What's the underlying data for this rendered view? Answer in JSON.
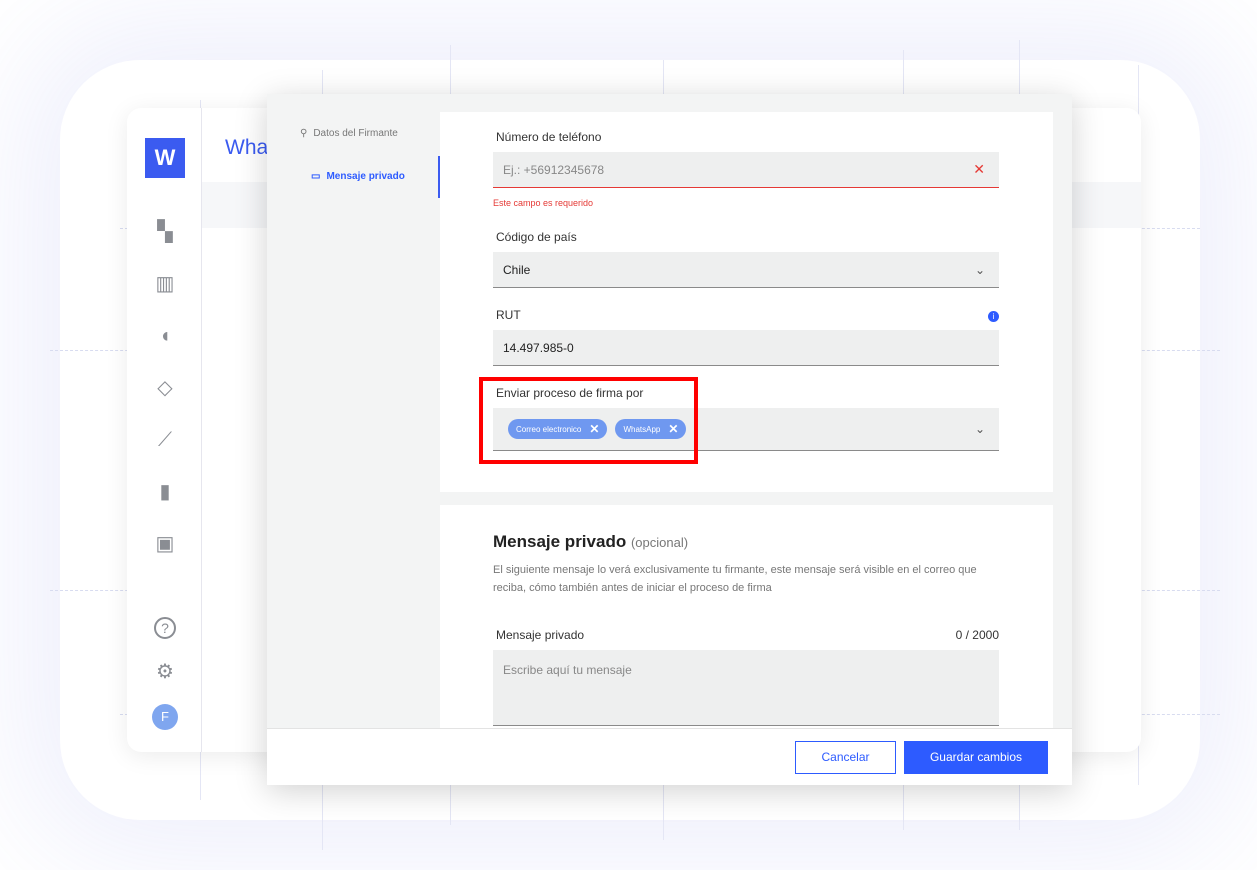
{
  "app": {
    "title_partial": "What",
    "logo": "W",
    "avatar_initial": "F",
    "accent": "#2d5bff"
  },
  "sidebar": {
    "icons": [
      "dashboard-icon",
      "library-icon",
      "contacts-icon",
      "templates-icon",
      "signature-feather-icon",
      "stats-icon",
      "inbox-icon",
      "help-icon",
      "settings-icon"
    ]
  },
  "modal": {
    "nav": [
      {
        "label": "Datos del Firmante",
        "active": false
      },
      {
        "label": "Mensaje privado",
        "active": true
      }
    ],
    "phone": {
      "label": "Número de teléfono",
      "placeholder": "Ej.: +56912345678",
      "error": "Este campo es requerido"
    },
    "country": {
      "label": "Código de país",
      "value": "Chile"
    },
    "rut": {
      "label": "RUT",
      "value": "14.497.985-0"
    },
    "send_via": {
      "label": "Enviar proceso de firma por",
      "chips": [
        "Correo electronico",
        "WhatsApp"
      ]
    },
    "private": {
      "title": "Mensaje privado",
      "optional": "(opcional)",
      "description": "El siguiente mensaje lo verá exclusivamente tu firmante, este mensaje será visible en el correo que reciba, cómo también antes de iniciar el proceso de firma",
      "field_label": "Mensaje privado",
      "counter": "0 / 2000",
      "placeholder": "Escribe aquí tu mensaje"
    },
    "footer": {
      "cancel": "Cancelar",
      "save": "Guardar cambios"
    }
  }
}
